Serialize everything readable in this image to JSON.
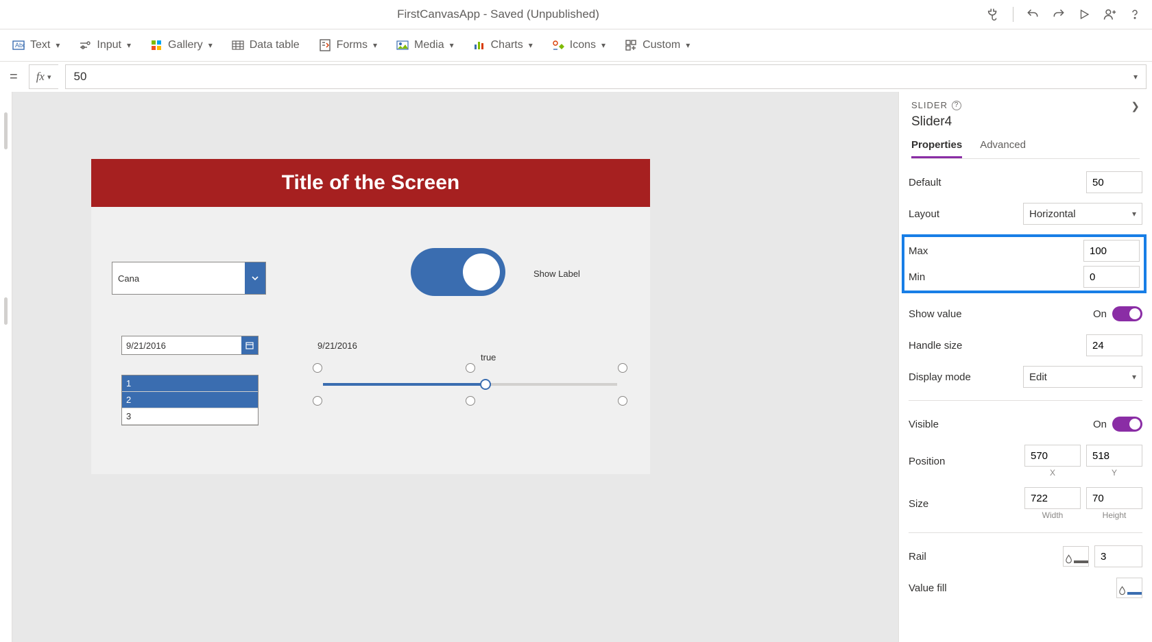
{
  "titleBar": {
    "title": "FirstCanvasApp - Saved (Unpublished)"
  },
  "ribbon": {
    "text": "Text",
    "input": "Input",
    "gallery": "Gallery",
    "dataTable": "Data table",
    "forms": "Forms",
    "media": "Media",
    "charts": "Charts",
    "icons": "Icons",
    "custom": "Custom"
  },
  "formulaBar": {
    "value": "50"
  },
  "canvas": {
    "screenTitle": "Title of the Screen",
    "dropdownText": "Cana",
    "toggleLabel": "Show Label",
    "dateValue": "9/21/2016",
    "dateLabel": "9/21/2016",
    "boolLabel": "true",
    "listItems": [
      "1",
      "2",
      "3"
    ]
  },
  "rightPane": {
    "type": "SLIDER",
    "name": "Slider4",
    "tabs": {
      "properties": "Properties",
      "advanced": "Advanced"
    },
    "props": {
      "defaultLabel": "Default",
      "defaultValue": "50",
      "layoutLabel": "Layout",
      "layoutValue": "Horizontal",
      "maxLabel": "Max",
      "maxValue": "100",
      "minLabel": "Min",
      "minValue": "0",
      "showValueLabel": "Show value",
      "showValueState": "On",
      "handleSizeLabel": "Handle size",
      "handleSizeValue": "24",
      "displayModeLabel": "Display mode",
      "displayModeValue": "Edit",
      "visibleLabel": "Visible",
      "visibleState": "On",
      "positionLabel": "Position",
      "positionX": "570",
      "positionY": "518",
      "xLabel": "X",
      "yLabel": "Y",
      "sizeLabel": "Size",
      "sizeW": "722",
      "sizeH": "70",
      "widthLabel": "Width",
      "heightLabel": "Height",
      "railLabel": "Rail",
      "railValue": "3",
      "valueFillLabel": "Value fill"
    }
  }
}
